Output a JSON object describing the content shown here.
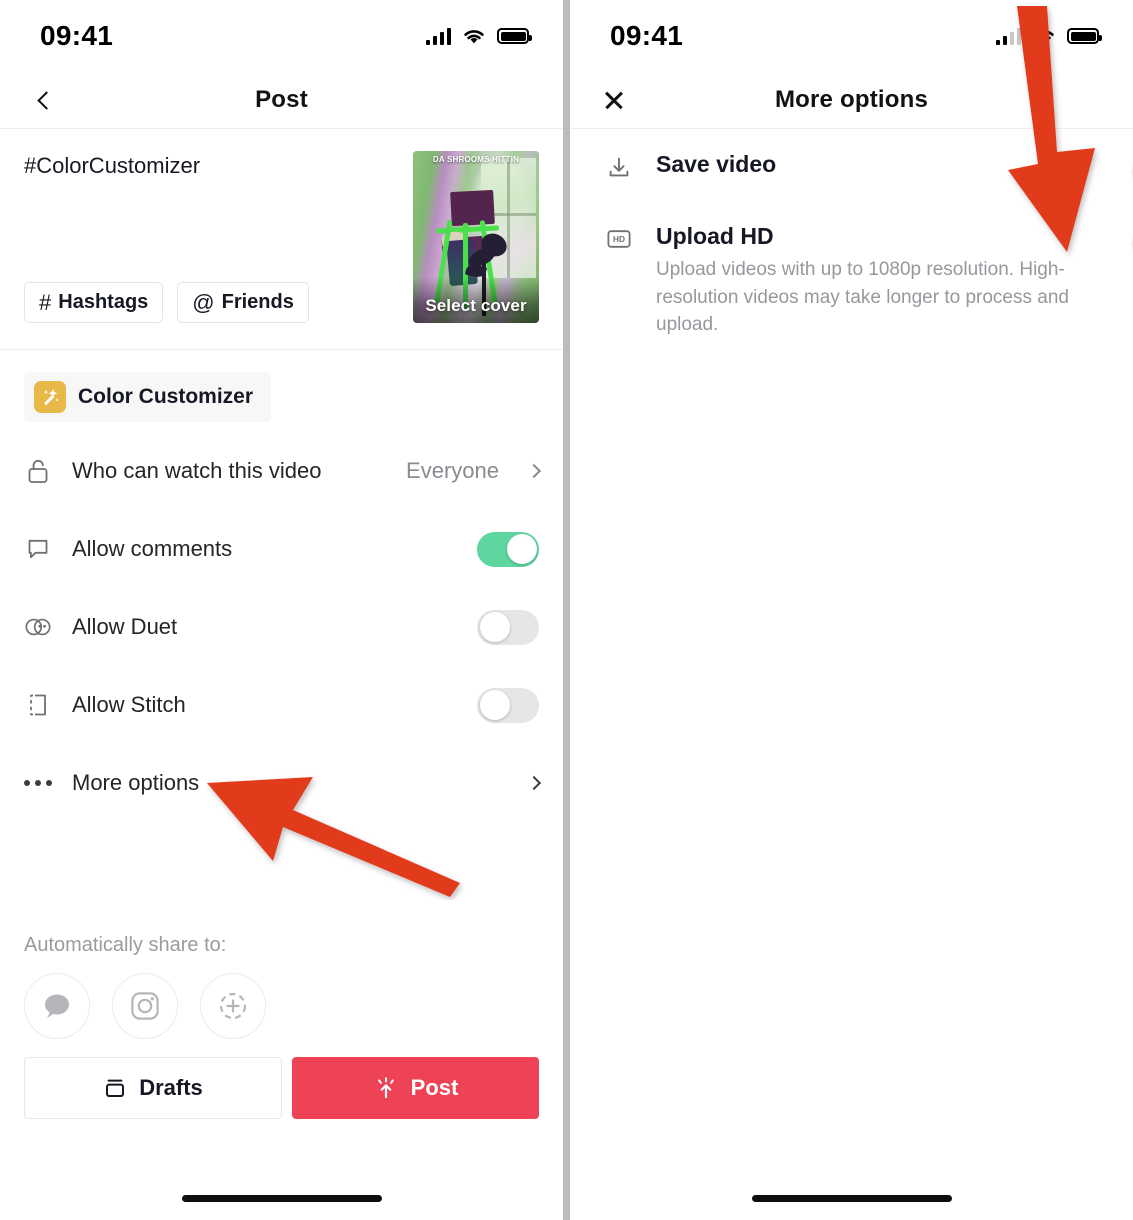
{
  "left_panel": {
    "status": {
      "time": "09:41",
      "signal_bars": 4,
      "wifi": "wifi-icon",
      "battery": "battery-icon"
    },
    "nav": {
      "back_icon": "chevron-left-icon",
      "title": "Post"
    },
    "caption": {
      "text": "#ColorCustomizer",
      "hashtags_button": "Hashtags",
      "hashtags_glyph": "#",
      "friends_button": "Friends",
      "friends_glyph": "@"
    },
    "thumbnail": {
      "overlay_top_text": "DA SHROOMS HITTIN",
      "select_cover_label": "Select cover"
    },
    "effect": {
      "name": "Color Customizer",
      "icon": "magic-wand-icon",
      "icon_color": "#E8B849"
    },
    "settings": [
      {
        "label": "Who can watch this video",
        "icon": "unlock-icon",
        "control": "value",
        "value": "Everyone"
      },
      {
        "label": "Allow comments",
        "icon": "comment-bubble-icon",
        "control": "toggle",
        "state": "on"
      },
      {
        "label": "Allow Duet",
        "icon": "duet-icon",
        "control": "toggle",
        "state": "off"
      },
      {
        "label": "Allow Stitch",
        "icon": "stitch-icon",
        "control": "toggle",
        "state": "off"
      },
      {
        "label": "More options",
        "icon": "ellipsis-icon",
        "control": "chevron"
      }
    ],
    "share": {
      "title": "Automatically share to:",
      "targets": [
        "messages-icon",
        "instagram-icon",
        "instagram-story-add-icon"
      ]
    },
    "buttons": {
      "drafts_label": "Drafts",
      "drafts_icon": "drafts-tray-icon",
      "post_label": "Post",
      "post_icon": "upload-sparkle-icon",
      "post_color": "#EE4356"
    }
  },
  "right_panel": {
    "status": {
      "time": "09:41",
      "signal_bars": 2,
      "wifi": "wifi-icon",
      "battery": "battery-icon"
    },
    "nav": {
      "close_icon": "close-x-icon",
      "title": "More options"
    },
    "options": [
      {
        "label": "Save video",
        "icon": "download-icon",
        "description": "",
        "state": "on"
      },
      {
        "label": "Upload HD",
        "icon": "hd-badge-icon",
        "description": "Upload videos with up to 1080p resolution. High-resolution videos may take longer to process and upload.",
        "state": "on"
      }
    ]
  },
  "annotations": {
    "color": "#E23B1E",
    "left_arrow": "arrow-pointing-to-more-options",
    "right_arrow": "arrow-pointing-to-upload-hd-toggle"
  },
  "theme": {
    "toggle_on": "#5FD6A0",
    "toggle_off": "#E6E6E8",
    "accent_red": "#EE4356",
    "text_primary": "#161823",
    "text_muted": "#97989D"
  }
}
